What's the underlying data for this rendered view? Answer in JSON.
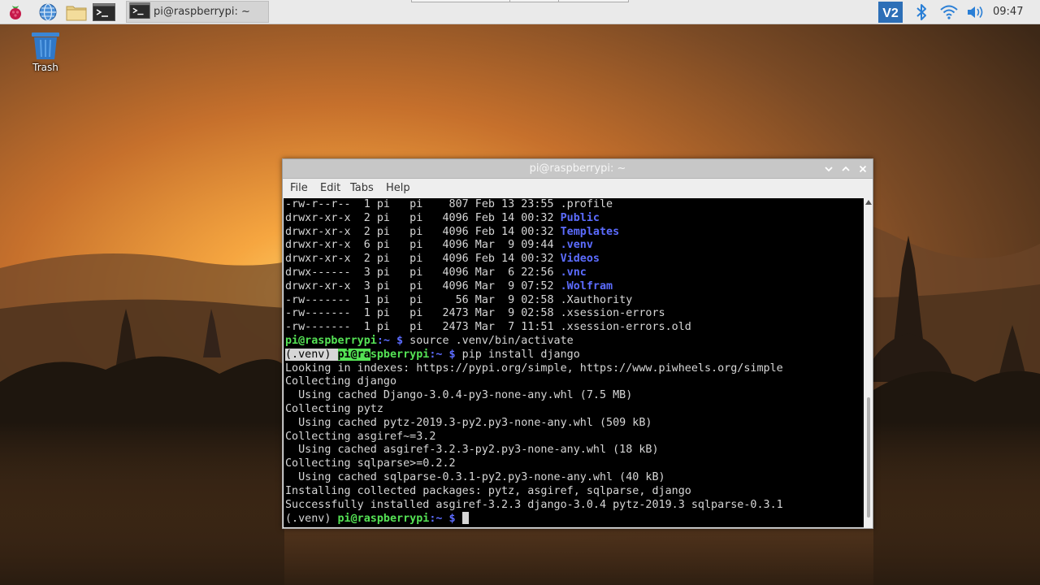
{
  "desktop": {
    "trash_label": "Trash"
  },
  "panel": {
    "launchers": [
      {
        "icon": "raspberry-menu-icon"
      },
      {
        "icon": "web-browser-icon"
      },
      {
        "icon": "file-manager-icon"
      },
      {
        "icon": "terminal-icon"
      }
    ],
    "task": {
      "label": "pi@raspberrypi: ~",
      "icon": "terminal-icon"
    },
    "tray": [
      "vnc-icon",
      "bluetooth-icon",
      "wifi-icon",
      "volume-icon"
    ],
    "clock": "09:47"
  },
  "window": {
    "title": "pi@raspberrypi: ~",
    "menu": [
      "File",
      "Edit",
      "Tabs",
      "Help"
    ],
    "lines": [
      [
        {
          "t": "-rw-r--r--  1 pi   pi    807 Feb 13 23:55 .profile"
        }
      ],
      [
        {
          "t": "drwxr-xr-x  2 pi   pi   4096 Feb 14 00:32 "
        },
        {
          "t": "Public",
          "c": "c-blue"
        }
      ],
      [
        {
          "t": "drwxr-xr-x  2 pi   pi   4096 Feb 14 00:32 "
        },
        {
          "t": "Templates",
          "c": "c-blue"
        }
      ],
      [
        {
          "t": "drwxr-xr-x  6 pi   pi   4096 Mar  9 09:44 "
        },
        {
          "t": ".venv",
          "c": "c-blue"
        }
      ],
      [
        {
          "t": "drwxr-xr-x  2 pi   pi   4096 Feb 14 00:32 "
        },
        {
          "t": "Videos",
          "c": "c-blue"
        }
      ],
      [
        {
          "t": "drwx------  3 pi   pi   4096 Mar  6 22:56 "
        },
        {
          "t": ".vnc",
          "c": "c-blue"
        }
      ],
      [
        {
          "t": "drwxr-xr-x  3 pi   pi   4096 Mar  9 07:52 "
        },
        {
          "t": ".Wolfram",
          "c": "c-blue"
        }
      ],
      [
        {
          "t": "-rw-------  1 pi   pi     56 Mar  9 02:58 .Xauthority"
        }
      ],
      [
        {
          "t": "-rw-------  1 pi   pi   2473 Mar  9 02:58 .xsession-errors"
        }
      ],
      [
        {
          "t": "-rw-------  1 pi   pi   2473 Mar  7 11:51 .xsession-errors.old"
        }
      ],
      [
        {
          "t": "pi@raspberrypi",
          "c": "c-green"
        },
        {
          "t": ":~ $",
          "c": "c-prompt-path"
        },
        {
          "t": " source .venv/bin/activate"
        }
      ],
      [
        {
          "t": "(.venv) ",
          "c": "hl-white"
        },
        {
          "t": "pi@ra",
          "c": "hl-green"
        },
        {
          "t": "spberrypi",
          "c": "c-green"
        },
        {
          "t": ":~ $",
          "c": "c-prompt-path"
        },
        {
          "t": " pip install django"
        }
      ],
      [
        {
          "t": "Looking in indexes: https://pypi.org/simple, https://www.piwheels.org/simple"
        }
      ],
      [
        {
          "t": "Collecting django"
        }
      ],
      [
        {
          "t": "  Using cached Django-3.0.4-py3-none-any.whl (7.5 MB)"
        }
      ],
      [
        {
          "t": "Collecting pytz"
        }
      ],
      [
        {
          "t": "  Using cached pytz-2019.3-py2.py3-none-any.whl (509 kB)"
        }
      ],
      [
        {
          "t": "Collecting asgiref~=3.2"
        }
      ],
      [
        {
          "t": "  Using cached asgiref-3.2.3-py2.py3-none-any.whl (18 kB)"
        }
      ],
      [
        {
          "t": "Collecting sqlparse>=0.2.2"
        }
      ],
      [
        {
          "t": "  Using cached sqlparse-0.3.1-py2.py3-none-any.whl (40 kB)"
        }
      ],
      [
        {
          "t": "Installing collected packages: pytz, asgiref, sqlparse, django"
        }
      ],
      [
        {
          "t": "Successfully installed asgiref-3.2.3 django-3.0.4 pytz-2019.3 sqlparse-0.3.1"
        }
      ],
      [
        {
          "t": "(.venv) "
        },
        {
          "t": "pi@raspberrypi",
          "c": "c-green"
        },
        {
          "t": ":~ $",
          "c": "c-prompt-path"
        },
        {
          "t": " "
        },
        {
          "cursor": true
        }
      ]
    ]
  },
  "colors": {
    "panel_bg": "#eaeaea",
    "terminal_bg": "#000000",
    "terminal_fg": "#d6d6d6",
    "prompt_user": "#55e355",
    "directory": "#5c6cff"
  }
}
